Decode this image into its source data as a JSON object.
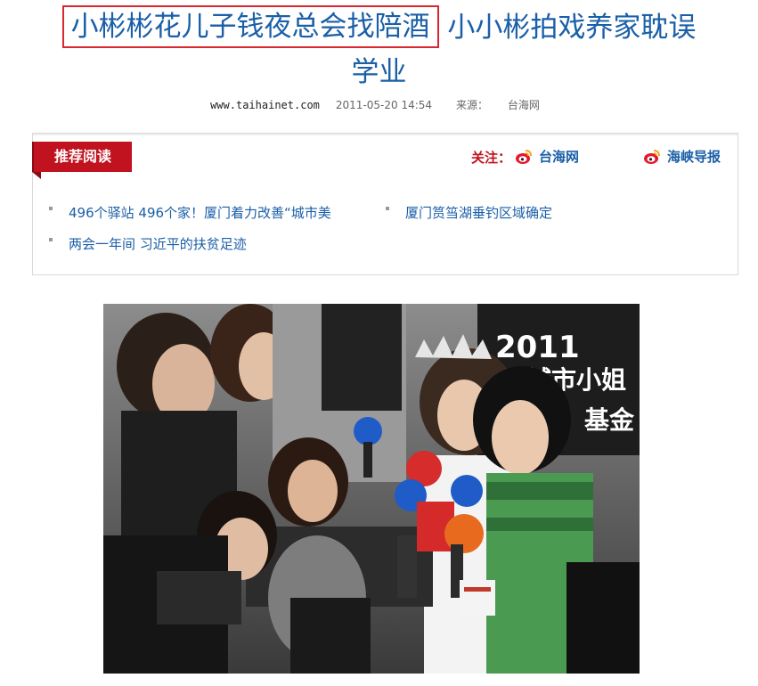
{
  "article": {
    "title_highlight": "小彬彬花儿子钱夜总会找陪酒",
    "title_rest": "小小彬拍戏养家耽误",
    "title_line2": "学业",
    "site": "www.taihainet.com",
    "datetime": "2011-05-20 14:54",
    "source_label": "来源：",
    "source_name": "台海网"
  },
  "recommend": {
    "tab_label": "推荐阅读",
    "follow_label": "关注：",
    "weibo_accounts": [
      {
        "name": "台海网",
        "icon": "weibo-icon"
      },
      {
        "name": "海峡导报",
        "icon": "weibo-icon"
      }
    ],
    "items": [
      "496个驿站 496个家！厦门着力改善“城市美",
      "厦门筼筜湖垂钓区域确定",
      "两会一年间 习近平的扶贫足迹"
    ]
  },
  "photo": {
    "sign_text_1": "2011",
    "sign_text_2": "城市小姐",
    "sign_text_3": "基金"
  },
  "colors": {
    "title": "#1a5fa8",
    "highlight_border": "#d9272e",
    "tab_bg": "#c1121f",
    "link": "#1a5fa8"
  }
}
